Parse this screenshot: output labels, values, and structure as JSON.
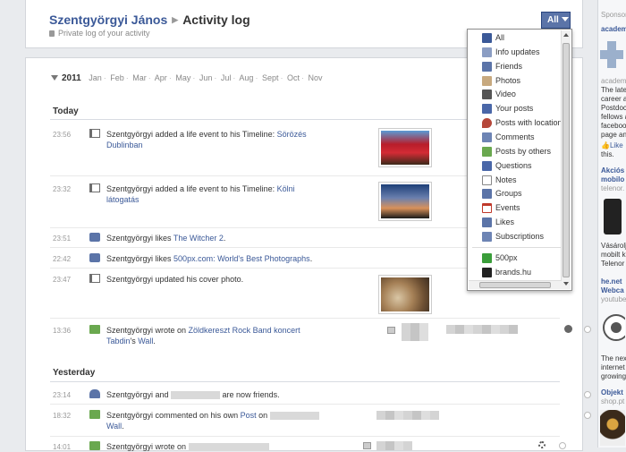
{
  "header": {
    "user_name": "Szentgyörgyi János",
    "page_name": "Activity log",
    "subtitle": "Private log of your activity",
    "filter_button": "All"
  },
  "timeline": {
    "year": "2011",
    "months": [
      "Jan",
      "Feb",
      "Mar",
      "Apr",
      "May",
      "Jun",
      "Jul",
      "Aug",
      "Sept",
      "Oct",
      "Nov"
    ]
  },
  "sections": {
    "today": "Today",
    "yesterday": "Yesterday"
  },
  "today_items": [
    {
      "time": "23:56",
      "text": "Szentgyörgyi added a life event to his Timeline: ",
      "link": "Sörözés Dublinban"
    },
    {
      "time": "23:32",
      "text": "Szentgyörgyi added a life event to his Timeline: ",
      "link": "Kölni látogatás"
    },
    {
      "time": "23:51",
      "text": "Szentgyörgyi likes ",
      "link": "The Witcher 2",
      "after": "."
    },
    {
      "time": "22:42",
      "text": "Szentgyörgyi likes ",
      "link": "500px.com: World's Best Photographs",
      "after": "."
    },
    {
      "time": "23:47",
      "text": "Szentgyörgyi updated his cover photo."
    },
    {
      "time": "13:36",
      "text": "Szentgyörgyi wrote on ",
      "link": "Zöldkereszt Rock Band koncert Tabdin",
      "after": "'s ",
      "link2": "Wall",
      "after2": "."
    }
  ],
  "yesterday_items": [
    {
      "time": "23:14",
      "text": "Szentgyörgyi and ",
      "after": " are now friends."
    },
    {
      "time": "18:32",
      "text": "Szentgyörgyi commented on his own ",
      "link": "Post",
      "after": " on",
      "link2": "Wall",
      "after2": "."
    },
    {
      "time": "14:01",
      "text": "Szentgyörgyi wrote on "
    }
  ],
  "filter_menu": {
    "items": [
      {
        "label": "All",
        "icon": "facebook-icon",
        "color": "#3b5998"
      },
      {
        "label": "Info updates",
        "icon": "info-edit-icon",
        "color": "#8b9dc3"
      },
      {
        "label": "Friends",
        "icon": "friends-icon",
        "color": "#5b74a8"
      },
      {
        "label": "Photos",
        "icon": "photos-icon",
        "color": "#c7a97f"
      },
      {
        "label": "Video",
        "icon": "video-icon",
        "color": "#555555"
      },
      {
        "label": "Your posts",
        "icon": "your-posts-icon",
        "color": "#4a67a8"
      },
      {
        "label": "Posts with location",
        "icon": "location-icon",
        "color": "#b5473a"
      },
      {
        "label": "Comments",
        "icon": "comments-icon",
        "color": "#6d84b4"
      },
      {
        "label": "Posts by others",
        "icon": "posts-by-others-icon",
        "color": "#6aa84f"
      },
      {
        "label": "Questions",
        "icon": "questions-icon",
        "color": "#4a67a8"
      },
      {
        "label": "Notes",
        "icon": "notes-icon",
        "color": "#f3f3f3"
      },
      {
        "label": "Groups",
        "icon": "groups-icon",
        "color": "#5b74a8"
      },
      {
        "label": "Events",
        "icon": "events-icon",
        "color": "#c0392b"
      },
      {
        "label": "Likes",
        "icon": "likes-icon",
        "color": "#5b74a8"
      },
      {
        "label": "Subscriptions",
        "icon": "subscriptions-icon",
        "color": "#6d84b4"
      }
    ],
    "apps": [
      {
        "label": "500px",
        "icon": "500px-icon",
        "color": "#3a9d3a"
      },
      {
        "label": "brands.hu",
        "icon": "brands-icon",
        "color": "#222222"
      }
    ]
  },
  "sidebar": {
    "sponsored": "Sponsore",
    "ad1_title": "academ",
    "ad1_sub": "academic",
    "ad1_lines": [
      "The late",
      "career a",
      "Postdoc",
      "fellows a",
      "faceboo",
      "page an"
    ],
    "ad1_like": "Like",
    "ad1_like_after": "this.",
    "ad2_title": "Akciós",
    "ad2_title2": "mobilo",
    "ad2_sub": "telenor.",
    "ad2_lines": [
      "Vásárolj",
      "mobilt k",
      "Telenor"
    ],
    "ad3_title": "he.net",
    "ad3_title2": "Webca",
    "ad3_sub": "youtube",
    "ad3_lines": [
      "The nex",
      "internet",
      "growing"
    ],
    "ad4_title": "Objekt",
    "ad4_sub": "shop.pt"
  }
}
